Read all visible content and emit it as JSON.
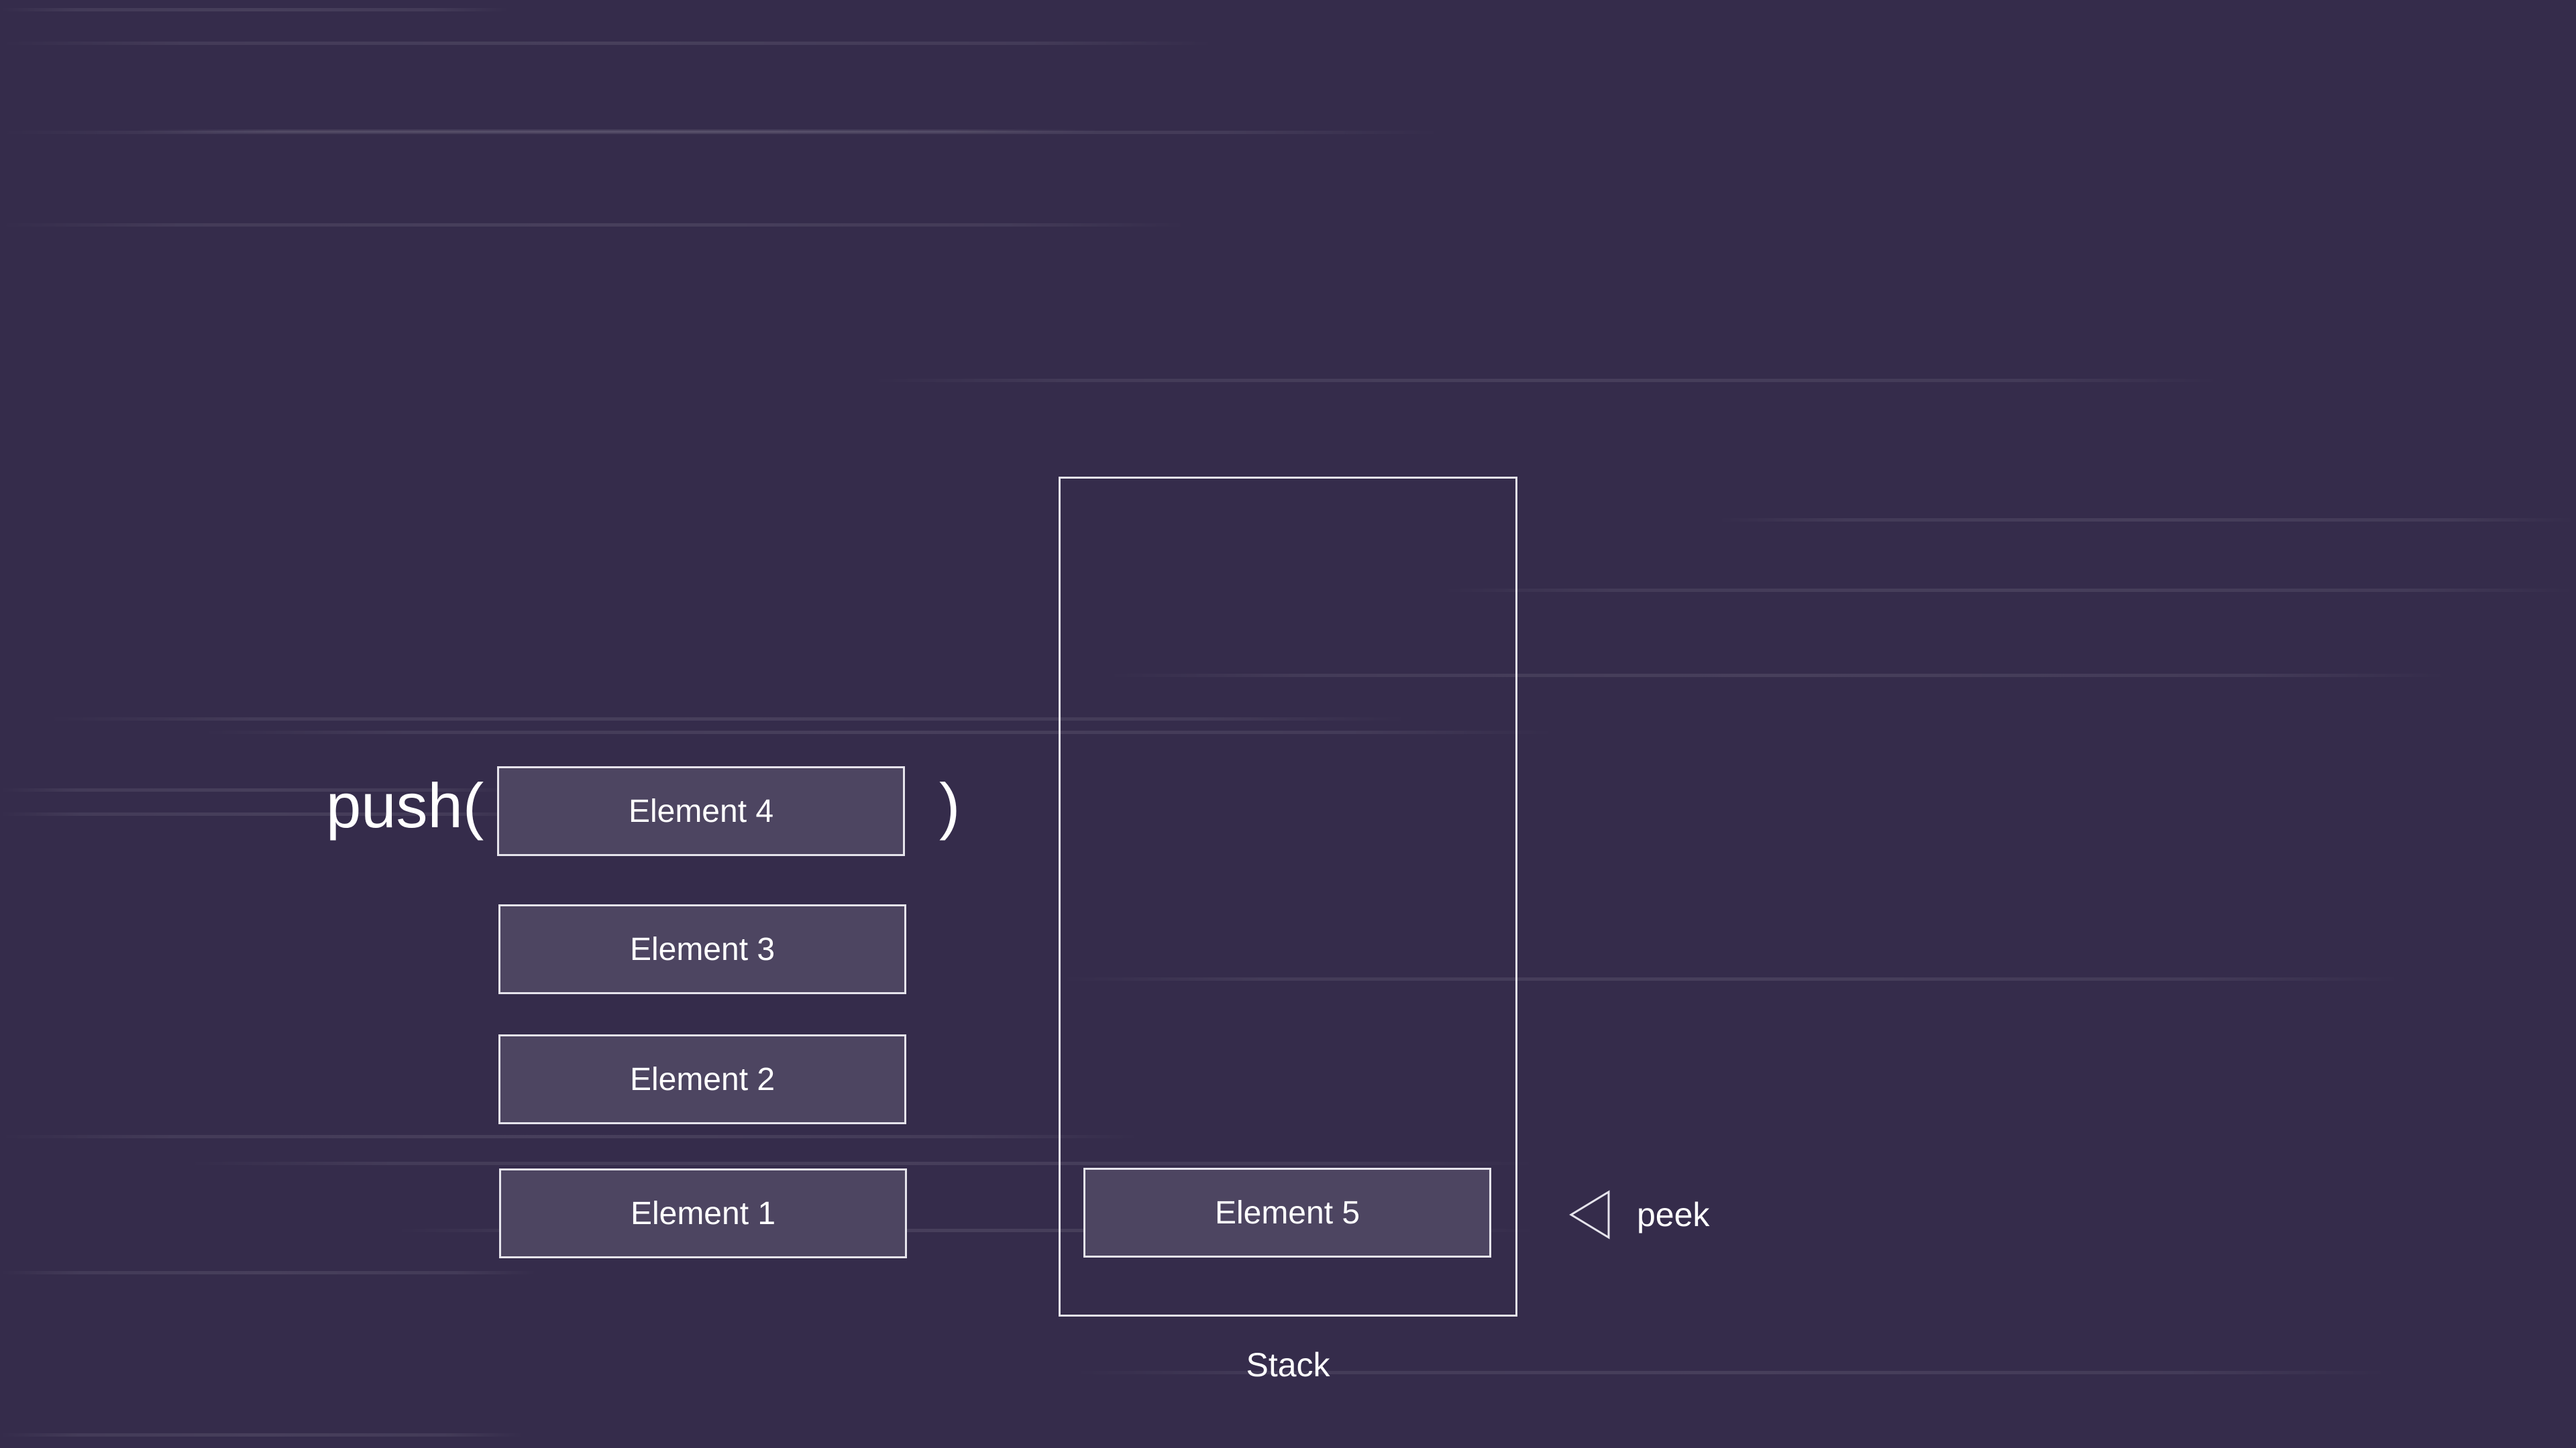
{
  "push": {
    "call_label": "push(",
    "close_paren": ")"
  },
  "queued_elements": [
    {
      "label": "Element 4"
    },
    {
      "label": "Element 3"
    },
    {
      "label": "Element 2"
    },
    {
      "label": "Element 1"
    }
  ],
  "stack": {
    "label": "Stack",
    "items": [
      {
        "label": "Element 5"
      }
    ]
  },
  "peek": {
    "label": "peek",
    "icon": "triangle-left-outline-icon"
  },
  "colors": {
    "background": "#352c4b",
    "element_fill": "#4d4561",
    "outline": "#e6e4ec",
    "text": "#ffffff"
  }
}
